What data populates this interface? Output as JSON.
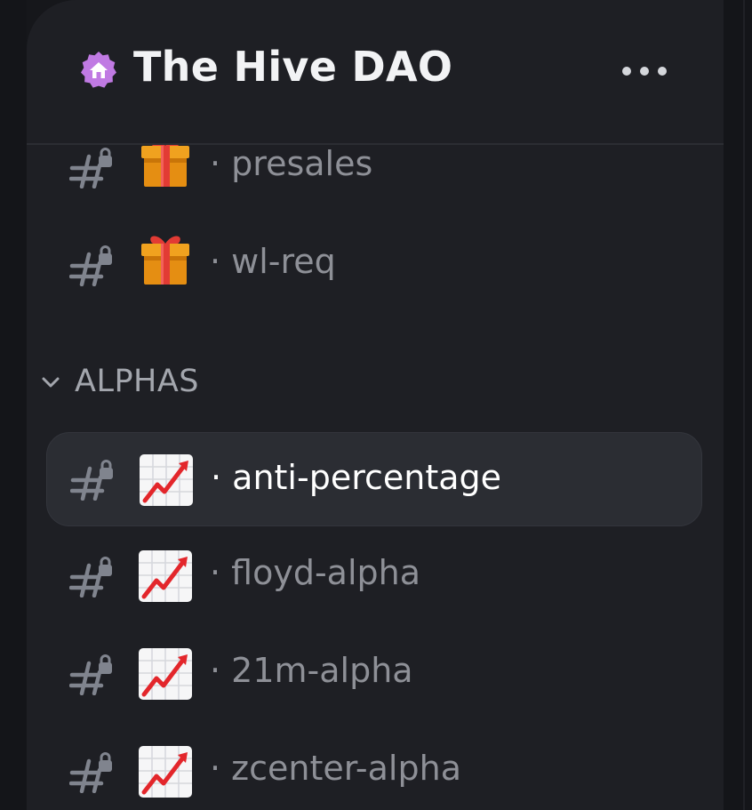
{
  "server": {
    "name": "The Hive DAO",
    "badge_icon": "server-home-badge-icon",
    "badge_color": "#c07ae3",
    "more_icon": "more-dots-icon"
  },
  "channels_top": [
    {
      "emoji": "wrapped-gift-icon",
      "name": "· presales"
    },
    {
      "emoji": "wrapped-gift-icon",
      "name": "· wl-req"
    }
  ],
  "category": {
    "label": "ALPHAS",
    "collapsed": false,
    "icon": "chevron-down-icon"
  },
  "channels_alphas": [
    {
      "emoji": "chart-increasing-icon",
      "name": "· anti-percentage",
      "active": true
    },
    {
      "emoji": "chart-increasing-icon",
      "name": "· floyd-alpha",
      "active": false
    },
    {
      "emoji": "chart-increasing-icon",
      "name": "· 21m-alpha",
      "active": false
    },
    {
      "emoji": "chart-increasing-icon",
      "name": "· zcenter-alpha",
      "active": false
    }
  ],
  "colors": {
    "panel": "#1e1f24",
    "active_row": "#2b2d33",
    "channel_text": "#8e9097",
    "active_text": "#ffffff"
  }
}
